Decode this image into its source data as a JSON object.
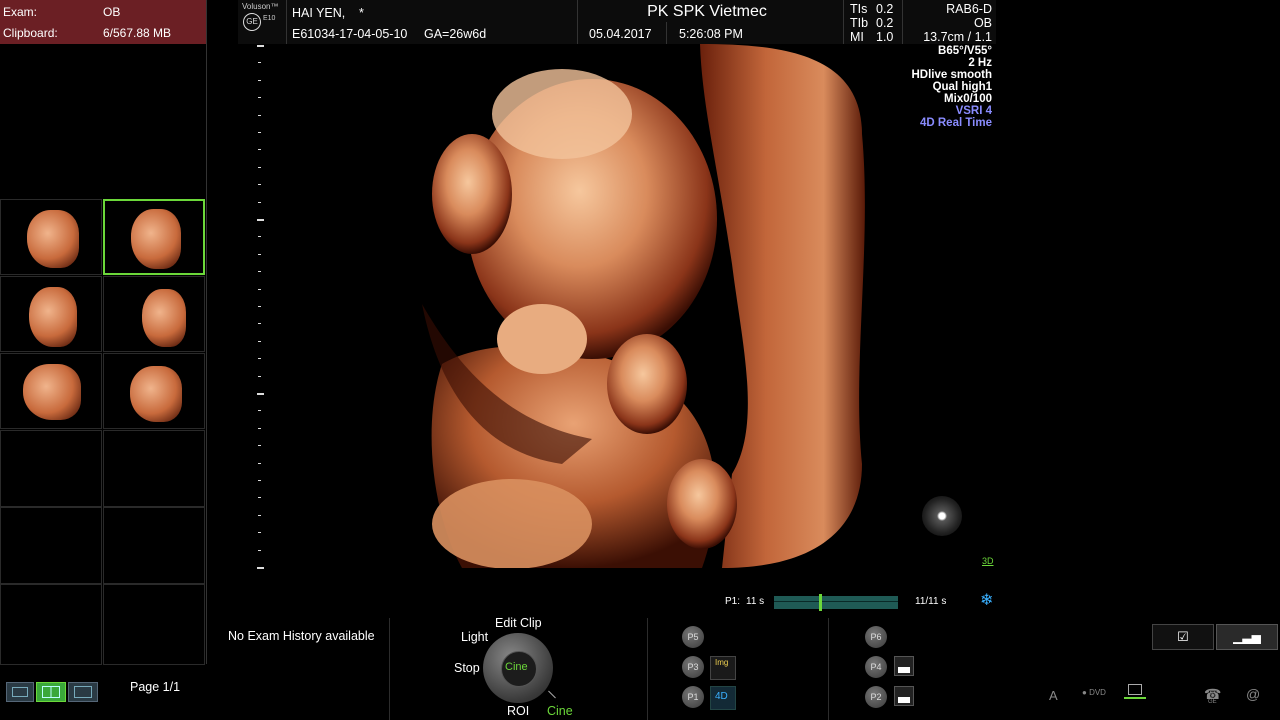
{
  "exam": {
    "label": "Exam:",
    "value": "OB",
    "clipboard_label": "Clipboard:",
    "clipboard_value": "6/567.88 MB"
  },
  "header": {
    "brand": "Voluson™",
    "brand_model": "E10",
    "patient": "HAI YEN,",
    "patient_mark": "*",
    "exam_id": "E61034-17-04-05-10",
    "ga": "GA=26w6d",
    "institution": "PK SPK Vietmec",
    "date": "05.04.2017",
    "time": "5:26:08 PM",
    "tis_label": "TIs",
    "tis_value": "0.2",
    "tib_label": "TIb",
    "tib_value": "0.2",
    "mi_label": "MI",
    "mi_value": "1.0",
    "probe": "RAB6-D",
    "app": "OB",
    "depth": "13.7cm / 1.1"
  },
  "image_info": [
    "B65°/V55°",
    "2 Hz",
    "HDlive smooth",
    "Qual high1",
    "Mix0/100"
  ],
  "image_info_blue": [
    "VSRI 4",
    "4D Real Time"
  ],
  "mode_tag": "3D",
  "cine": {
    "p1_label": "P1:",
    "p1_time": "11 s",
    "frames": "11/11 s"
  },
  "no_history": "No Exam History available",
  "dial": {
    "edit_clip": "Edit Clip",
    "light": "Light",
    "stop": "Stop",
    "center": "Cine",
    "roi": "ROI",
    "cine": "Cine"
  },
  "presets": {
    "p5": "P5",
    "p3": "P3",
    "p1": "P1",
    "img": "Img",
    "mode4d": "4D",
    "p6": "P6",
    "p4": "P4",
    "p2": "P2"
  },
  "page": "Page 1/1",
  "status_icons": [
    "A",
    "DVD",
    "GE",
    "@"
  ],
  "colors": {
    "accent_green": "#6cd83a",
    "header_red": "#6b1f24",
    "info_blue": "#8a8cff",
    "cine_bar": "#1f5a55"
  }
}
